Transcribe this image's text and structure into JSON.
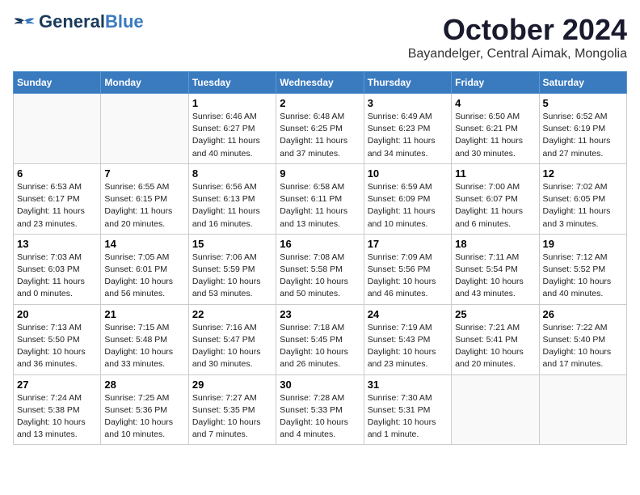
{
  "header": {
    "logo_general": "General",
    "logo_blue": "Blue",
    "month": "October 2024",
    "location": "Bayandelger, Central Aimak, Mongolia"
  },
  "days_of_week": [
    "Sunday",
    "Monday",
    "Tuesday",
    "Wednesday",
    "Thursday",
    "Friday",
    "Saturday"
  ],
  "weeks": [
    [
      {
        "day": "",
        "info": ""
      },
      {
        "day": "",
        "info": ""
      },
      {
        "day": "1",
        "info": "Sunrise: 6:46 AM\nSunset: 6:27 PM\nDaylight: 11 hours and 40 minutes."
      },
      {
        "day": "2",
        "info": "Sunrise: 6:48 AM\nSunset: 6:25 PM\nDaylight: 11 hours and 37 minutes."
      },
      {
        "day": "3",
        "info": "Sunrise: 6:49 AM\nSunset: 6:23 PM\nDaylight: 11 hours and 34 minutes."
      },
      {
        "day": "4",
        "info": "Sunrise: 6:50 AM\nSunset: 6:21 PM\nDaylight: 11 hours and 30 minutes."
      },
      {
        "day": "5",
        "info": "Sunrise: 6:52 AM\nSunset: 6:19 PM\nDaylight: 11 hours and 27 minutes."
      }
    ],
    [
      {
        "day": "6",
        "info": "Sunrise: 6:53 AM\nSunset: 6:17 PM\nDaylight: 11 hours and 23 minutes."
      },
      {
        "day": "7",
        "info": "Sunrise: 6:55 AM\nSunset: 6:15 PM\nDaylight: 11 hours and 20 minutes."
      },
      {
        "day": "8",
        "info": "Sunrise: 6:56 AM\nSunset: 6:13 PM\nDaylight: 11 hours and 16 minutes."
      },
      {
        "day": "9",
        "info": "Sunrise: 6:58 AM\nSunset: 6:11 PM\nDaylight: 11 hours and 13 minutes."
      },
      {
        "day": "10",
        "info": "Sunrise: 6:59 AM\nSunset: 6:09 PM\nDaylight: 11 hours and 10 minutes."
      },
      {
        "day": "11",
        "info": "Sunrise: 7:00 AM\nSunset: 6:07 PM\nDaylight: 11 hours and 6 minutes."
      },
      {
        "day": "12",
        "info": "Sunrise: 7:02 AM\nSunset: 6:05 PM\nDaylight: 11 hours and 3 minutes."
      }
    ],
    [
      {
        "day": "13",
        "info": "Sunrise: 7:03 AM\nSunset: 6:03 PM\nDaylight: 11 hours and 0 minutes."
      },
      {
        "day": "14",
        "info": "Sunrise: 7:05 AM\nSunset: 6:01 PM\nDaylight: 10 hours and 56 minutes."
      },
      {
        "day": "15",
        "info": "Sunrise: 7:06 AM\nSunset: 5:59 PM\nDaylight: 10 hours and 53 minutes."
      },
      {
        "day": "16",
        "info": "Sunrise: 7:08 AM\nSunset: 5:58 PM\nDaylight: 10 hours and 50 minutes."
      },
      {
        "day": "17",
        "info": "Sunrise: 7:09 AM\nSunset: 5:56 PM\nDaylight: 10 hours and 46 minutes."
      },
      {
        "day": "18",
        "info": "Sunrise: 7:11 AM\nSunset: 5:54 PM\nDaylight: 10 hours and 43 minutes."
      },
      {
        "day": "19",
        "info": "Sunrise: 7:12 AM\nSunset: 5:52 PM\nDaylight: 10 hours and 40 minutes."
      }
    ],
    [
      {
        "day": "20",
        "info": "Sunrise: 7:13 AM\nSunset: 5:50 PM\nDaylight: 10 hours and 36 minutes."
      },
      {
        "day": "21",
        "info": "Sunrise: 7:15 AM\nSunset: 5:48 PM\nDaylight: 10 hours and 33 minutes."
      },
      {
        "day": "22",
        "info": "Sunrise: 7:16 AM\nSunset: 5:47 PM\nDaylight: 10 hours and 30 minutes."
      },
      {
        "day": "23",
        "info": "Sunrise: 7:18 AM\nSunset: 5:45 PM\nDaylight: 10 hours and 26 minutes."
      },
      {
        "day": "24",
        "info": "Sunrise: 7:19 AM\nSunset: 5:43 PM\nDaylight: 10 hours and 23 minutes."
      },
      {
        "day": "25",
        "info": "Sunrise: 7:21 AM\nSunset: 5:41 PM\nDaylight: 10 hours and 20 minutes."
      },
      {
        "day": "26",
        "info": "Sunrise: 7:22 AM\nSunset: 5:40 PM\nDaylight: 10 hours and 17 minutes."
      }
    ],
    [
      {
        "day": "27",
        "info": "Sunrise: 7:24 AM\nSunset: 5:38 PM\nDaylight: 10 hours and 13 minutes."
      },
      {
        "day": "28",
        "info": "Sunrise: 7:25 AM\nSunset: 5:36 PM\nDaylight: 10 hours and 10 minutes."
      },
      {
        "day": "29",
        "info": "Sunrise: 7:27 AM\nSunset: 5:35 PM\nDaylight: 10 hours and 7 minutes."
      },
      {
        "day": "30",
        "info": "Sunrise: 7:28 AM\nSunset: 5:33 PM\nDaylight: 10 hours and 4 minutes."
      },
      {
        "day": "31",
        "info": "Sunrise: 7:30 AM\nSunset: 5:31 PM\nDaylight: 10 hours and 1 minute."
      },
      {
        "day": "",
        "info": ""
      },
      {
        "day": "",
        "info": ""
      }
    ]
  ]
}
